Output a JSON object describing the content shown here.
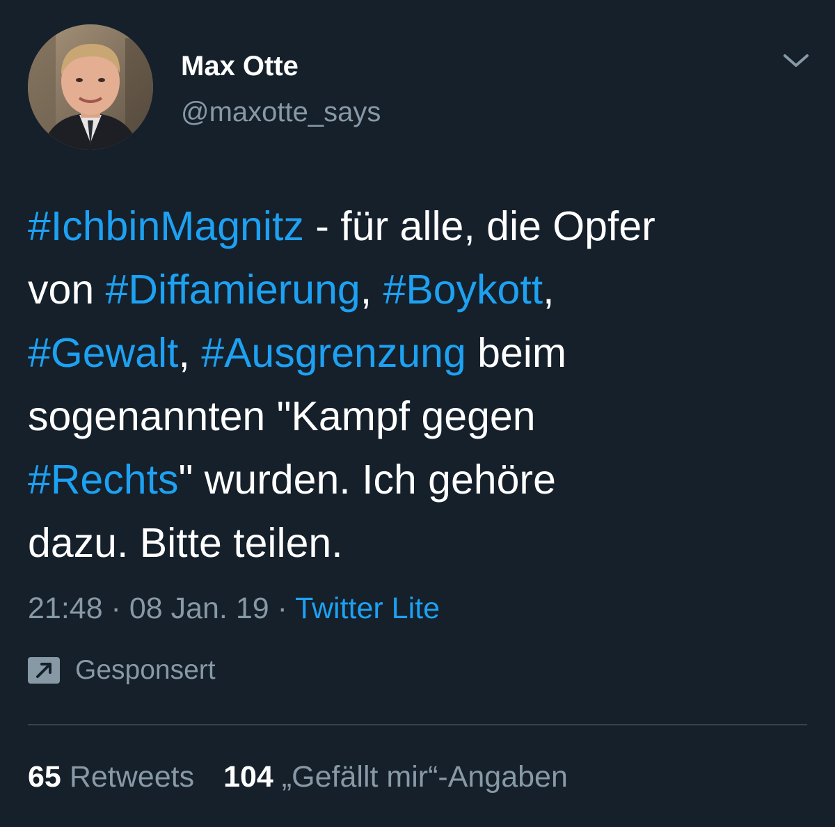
{
  "colors": {
    "background": "#15202b",
    "text_primary": "#ffffff",
    "text_secondary": "#8899a6",
    "link": "#1da1f2",
    "divider": "#38444d"
  },
  "author": {
    "display_name": "Max Otte",
    "handle": "@maxotte_says",
    "avatar_icon": "profile-photo"
  },
  "menu": {
    "icon": "chevron-down-icon"
  },
  "tweet": {
    "lines": [
      [
        {
          "text": "#IchbinMagnitz",
          "hashtag": true
        },
        {
          "text": " - für alle, die Opfer",
          "hashtag": false
        }
      ],
      [
        {
          "text": "von ",
          "hashtag": false
        },
        {
          "text": "#Diffamierung",
          "hashtag": true
        },
        {
          "text": ", ",
          "hashtag": false
        },
        {
          "text": "#Boykott",
          "hashtag": true
        },
        {
          "text": ",",
          "hashtag": false
        }
      ],
      [
        {
          "text": "#Gewalt",
          "hashtag": true
        },
        {
          "text": ", ",
          "hashtag": false
        },
        {
          "text": "#Ausgrenzung",
          "hashtag": true
        },
        {
          "text": " beim",
          "hashtag": false
        }
      ],
      [
        {
          "text": "sogenannten \"Kampf gegen",
          "hashtag": false
        }
      ],
      [
        {
          "text": "#Rechts",
          "hashtag": true
        },
        {
          "text": "\" wurden. Ich gehöre",
          "hashtag": false
        }
      ],
      [
        {
          "text": "dazu. Bitte teilen.",
          "hashtag": false
        }
      ]
    ]
  },
  "meta": {
    "time": "21:48",
    "separator": " · ",
    "date": "08 Jan. 19",
    "source": "Twitter Lite"
  },
  "promoted": {
    "icon": "promoted-arrow-icon",
    "label": "Gesponsert"
  },
  "stats": {
    "retweets_count": "65",
    "retweets_label": "Retweets",
    "likes_count": "104",
    "likes_label": "„Gefällt mir“-Angaben"
  }
}
